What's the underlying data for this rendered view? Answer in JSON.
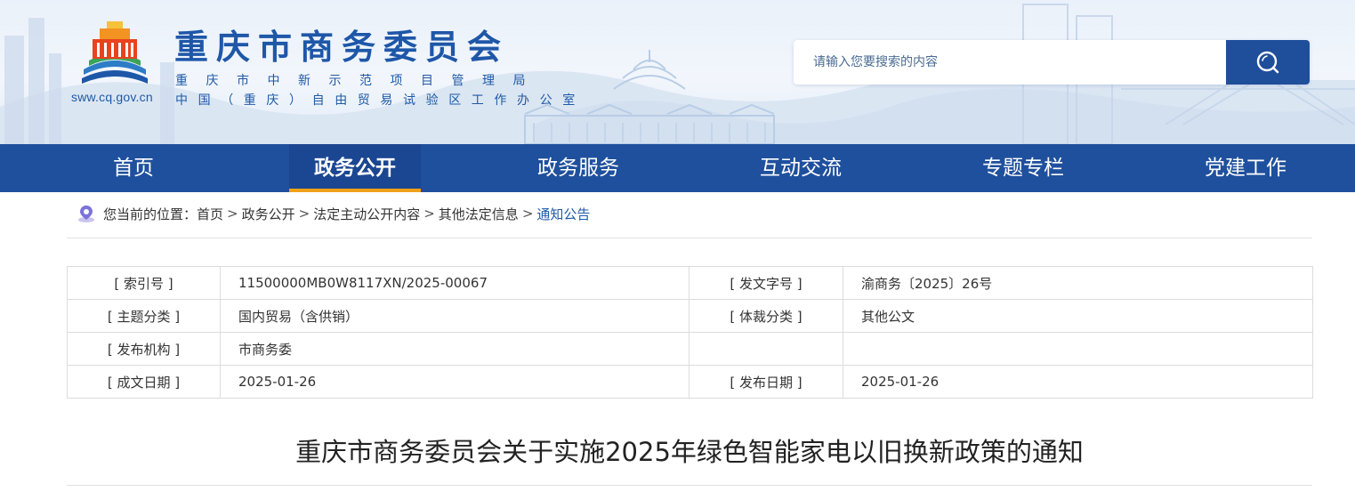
{
  "header": {
    "site_title": "重庆市商务委员会",
    "subtitle_1": "重庆市中新示范项目管理局",
    "subtitle_2": "中国（重庆）自由贸易试验区工作办公室",
    "logo_url": "sww.cq.gov.cn",
    "search": {
      "placeholder": "请输入您要搜索的内容",
      "value": "",
      "icon": "search-icon"
    }
  },
  "nav": {
    "items": [
      {
        "label": "首页",
        "active": false
      },
      {
        "label": "政务公开",
        "active": true
      },
      {
        "label": "政务服务",
        "active": false
      },
      {
        "label": "互动交流",
        "active": false
      },
      {
        "label": "专题专栏",
        "active": false
      },
      {
        "label": "党建工作",
        "active": false
      }
    ]
  },
  "breadcrumb": {
    "prefix": "您当前的位置：",
    "icon": "location-pin-icon",
    "separator": ">",
    "items": [
      "首页",
      "政务公开",
      "法定主动公开内容",
      "其他法定信息",
      "通知公告"
    ]
  },
  "info_table": {
    "rows": [
      [
        {
          "label": "[ 索引号 ]",
          "value": "11500000MB0W8117XN/2025-00067"
        },
        {
          "label": "[ 发文字号 ]",
          "value": "渝商务〔2025〕26号"
        }
      ],
      [
        {
          "label": "[ 主题分类 ]",
          "value": "国内贸易（含供销）"
        },
        {
          "label": "[ 体裁分类 ]",
          "value": "其他公文"
        }
      ],
      [
        {
          "label": "[ 发布机构 ]",
          "value": "市商务委"
        },
        {
          "label": "",
          "value": ""
        }
      ],
      [
        {
          "label": "[ 成文日期 ]",
          "value": "2025-01-26"
        },
        {
          "label": "[ 发布日期 ]",
          "value": "2025-01-26"
        }
      ]
    ]
  },
  "article": {
    "title": "重庆市商务委员会关于实施2025年绿色智能家电以旧换新政策的通知"
  },
  "colors": {
    "brand_blue": "#1e57a8",
    "nav_blue": "#1f509d",
    "active_underline": "#f0a11a"
  }
}
